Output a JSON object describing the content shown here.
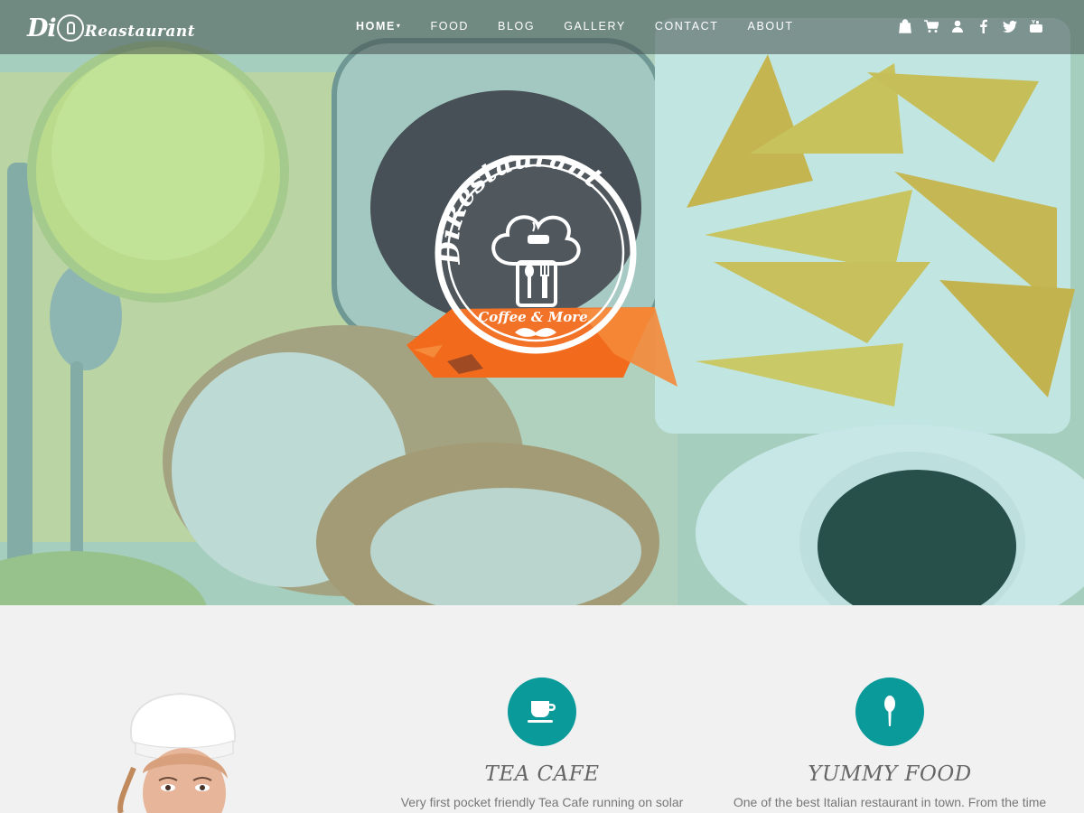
{
  "brand": {
    "di": "Di",
    "rest": "Reastaurant"
  },
  "nav": {
    "items": [
      {
        "label": "HOME"
      },
      {
        "label": "FOOD"
      },
      {
        "label": "BLOG"
      },
      {
        "label": "GALLERY"
      },
      {
        "label": "CONTACT"
      },
      {
        "label": "ABOUT"
      }
    ],
    "icons": [
      "shopping-bag-icon",
      "cart-icon",
      "user-icon",
      "facebook-icon",
      "twitter-icon",
      "youtube-icon"
    ]
  },
  "hero_logo": {
    "top_text": "DiRestaurant",
    "ribbon_text": "Coffee & More"
  },
  "features": [
    {
      "icon": "coffee-cup-icon",
      "title": "TEA CAFE",
      "text": "Very first pocket friendly Tea Cafe running on solar"
    },
    {
      "icon": "spoon-icon",
      "title": "YUMMY FOOD",
      "text": "One of the best Italian restaurant in town. From the time"
    }
  ],
  "colors": {
    "accent": "#0b9a9a",
    "ribbon": "#f26b1d",
    "navbar": "#46504e"
  }
}
